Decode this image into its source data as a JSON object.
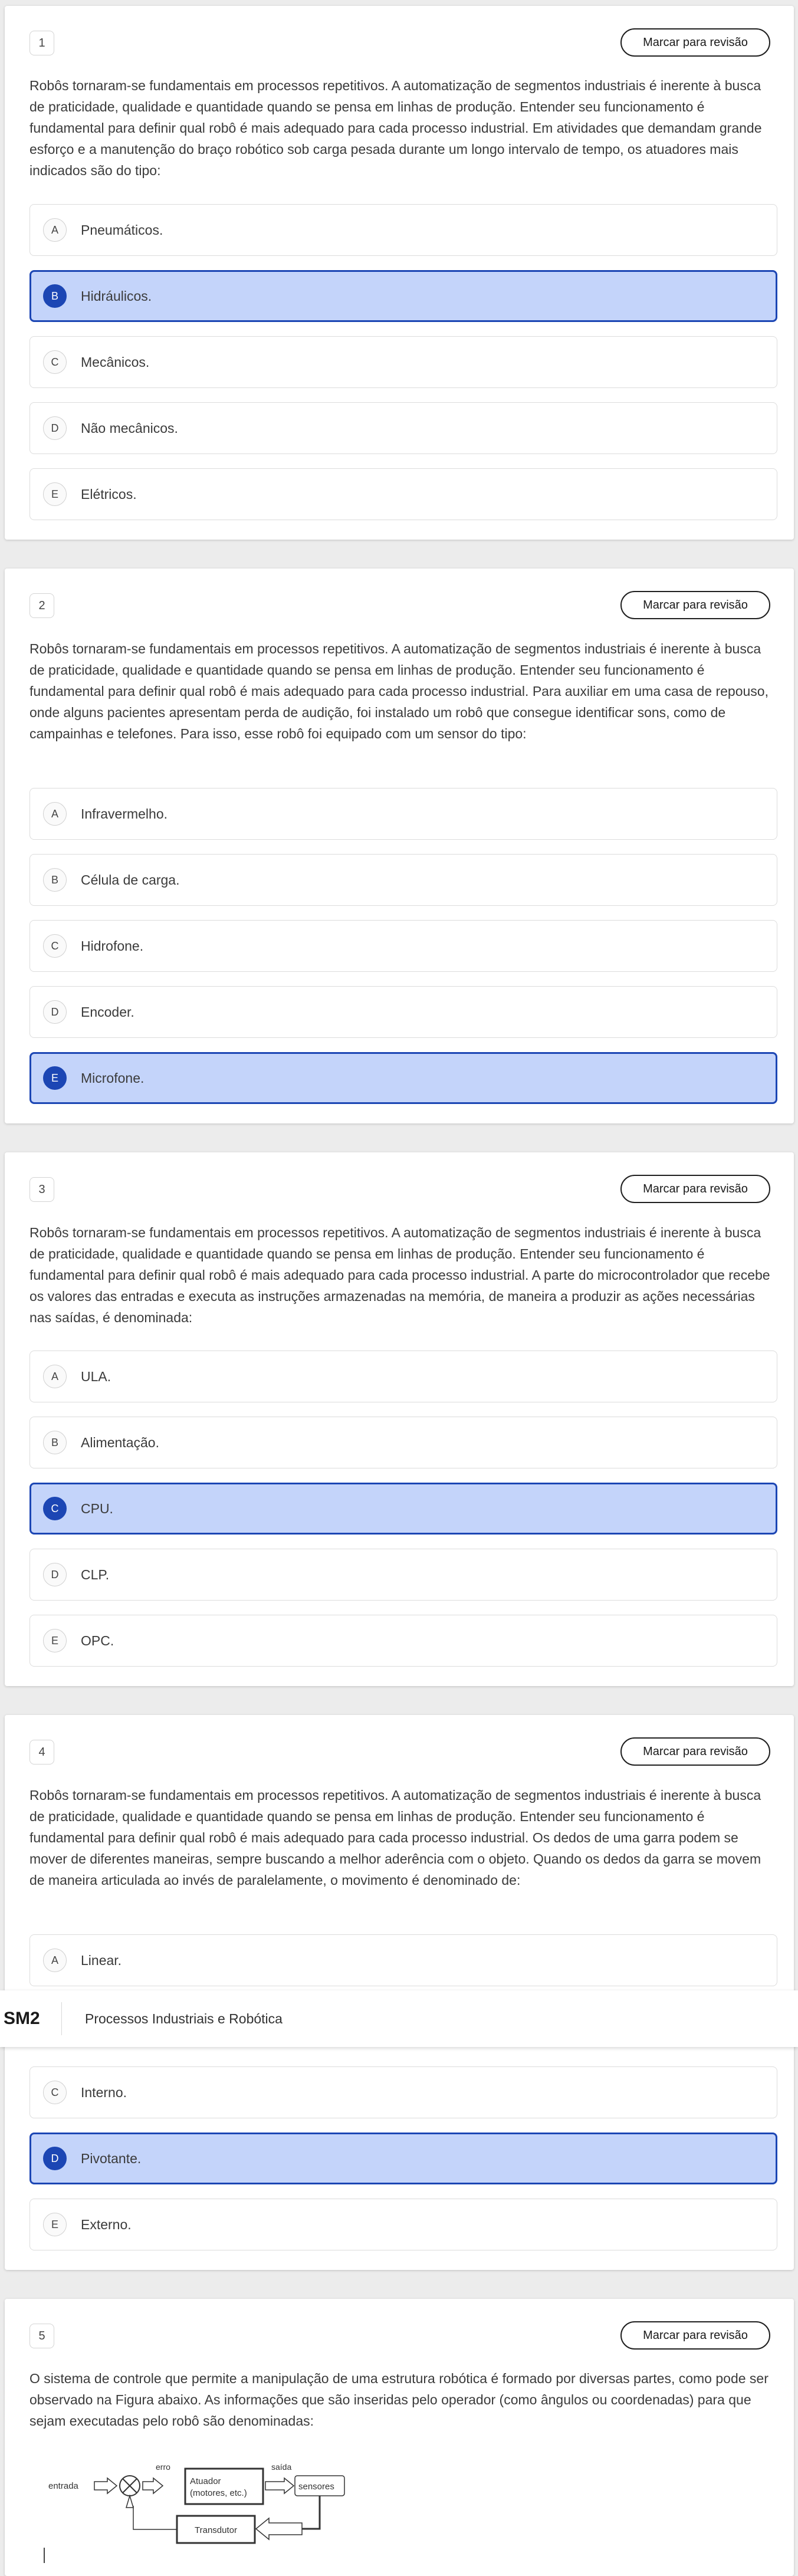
{
  "review_label": "Marcar para revisão",
  "header": {
    "brand": "SM2",
    "course": "Processos Industriais e Robótica"
  },
  "questions": [
    {
      "number": "1",
      "text": "Robôs tornaram-se fundamentais em processos repetitivos. A automatização de segmentos industriais é inerente à busca de praticidade, qualidade e quantidade quando se pensa em linhas de produção. Entender seu funcionamento é fundamental para definir qual robô é mais adequado para cada processo industrial. Em atividades que demandam grande esforço e a manutenção do braço robótico sob carga pesada durante um longo intervalo de tempo, os atuadores mais indicados são do tipo:",
      "selected": "B",
      "options": [
        {
          "letter": "A",
          "text": "Pneumáticos."
        },
        {
          "letter": "B",
          "text": "Hidráulicos."
        },
        {
          "letter": "C",
          "text": "Mecânicos."
        },
        {
          "letter": "D",
          "text": "Não mecânicos."
        },
        {
          "letter": "E",
          "text": "Elétricos."
        }
      ]
    },
    {
      "number": "2",
      "text": "Robôs tornaram-se fundamentais em processos repetitivos. A automatização de segmentos industriais é inerente à busca de praticidade, qualidade e quantidade quando se pensa em linhas de produção. Entender seu funcionamento é fundamental para definir qual robô é mais adequado para cada processo industrial. Para auxiliar em uma casa de repouso, onde alguns pacientes apresentam perda de audição, foi instalado um robô que consegue identificar sons, como de campainhas e telefones. Para isso, esse robô foi equipado com um sensor do tipo:",
      "selected": "E",
      "options": [
        {
          "letter": "A",
          "text": "Infravermelho."
        },
        {
          "letter": "B",
          "text": "Célula de carga."
        },
        {
          "letter": "C",
          "text": "Hidrofone."
        },
        {
          "letter": "D",
          "text": "Encoder."
        },
        {
          "letter": "E",
          "text": "Microfone."
        }
      ]
    },
    {
      "number": "3",
      "text": "Robôs tornaram-se fundamentais em processos repetitivos. A automatização de segmentos industriais é inerente à busca de praticidade, qualidade e quantidade quando se pensa em linhas de produção. Entender seu funcionamento é fundamental para definir qual robô é mais adequado para cada processo industrial. A parte do microcontrolador que recebe os valores das entradas e executa as instruções armazenadas na memória, de maneira a produzir as ações necessárias nas saídas, é denominada:",
      "selected": "C",
      "options": [
        {
          "letter": "A",
          "text": "ULA."
        },
        {
          "letter": "B",
          "text": "Alimentação."
        },
        {
          "letter": "C",
          "text": "CPU."
        },
        {
          "letter": "D",
          "text": "CLP."
        },
        {
          "letter": "E",
          "text": "OPC."
        }
      ]
    },
    {
      "number": "4",
      "text": "Robôs tornaram-se fundamentais em processos repetitivos. A automatização de segmentos industriais é inerente à busca de praticidade, qualidade e quantidade quando se pensa em linhas de produção. Entender seu funcionamento é fundamental para definir qual robô é mais adequado para cada processo industrial. Os dedos de uma garra podem se mover de diferentes maneiras, sempre buscando a melhor aderência com o objeto. Quando os dedos da garra se movem de maneira articulada ao invés de paralelamente, o movimento é denominado de:",
      "selected": "D",
      "options": [
        {
          "letter": "A",
          "text": "Linear."
        },
        {
          "letter": "C",
          "text": "Interno."
        },
        {
          "letter": "D",
          "text": "Pivotante."
        },
        {
          "letter": "E",
          "text": "Externo."
        }
      ]
    },
    {
      "number": "5",
      "text": "O sistema de controle que permite a manipulação de uma estrutura robótica é formado por diversas partes, como pode ser observado na Figura abaixo. As informações que são inseridas pelo operador (como ângulos ou coordenadas) para que sejam executadas pelo robô são denominadas:",
      "diagram": {
        "entrada": "entrada",
        "erro": "erro",
        "atuador_line1": "Atuador",
        "atuador_line2": "(motores, etc.)",
        "saida": "saída",
        "sensores": "sensores",
        "transdutor": "Transdutor"
      }
    }
  ]
}
